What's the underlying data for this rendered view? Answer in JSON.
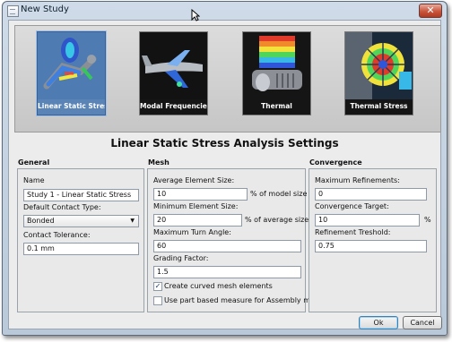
{
  "window": {
    "title": "New Study",
    "close_glyph": "✕"
  },
  "studies": [
    {
      "label": "Linear Static Stress",
      "selected": true
    },
    {
      "label": "Modal Frequencies",
      "selected": false
    },
    {
      "label": "Thermal",
      "selected": false
    },
    {
      "label": "Thermal Stress",
      "selected": false
    }
  ],
  "heading": "Linear Static Stress Analysis Settings",
  "general": {
    "title": "General",
    "name_label": "Name",
    "name_value": "Study 1 - Linear Static Stress",
    "contact_type_label": "Default Contact Type:",
    "contact_type_value": "Bonded",
    "contact_tolerance_label": "Contact Tolerance:",
    "contact_tolerance_value": "0.1 mm"
  },
  "mesh": {
    "title": "Mesh",
    "avg_size_label": "Average Element Size:",
    "avg_size_value": "10",
    "avg_size_suffix": "% of model size",
    "min_size_label": "Minimum Element Size:",
    "min_size_value": "20",
    "min_size_suffix": "% of average size",
    "turn_angle_label": "Maximum Turn Angle:",
    "turn_angle_value": "60",
    "grading_label": "Grading Factor:",
    "grading_value": "1.5",
    "curved_label": "Create curved mesh elements",
    "curved_checked": true,
    "part_based_label": "Use part based measure for Assembly mesh",
    "part_based_checked": false
  },
  "convergence": {
    "title": "Convergence",
    "max_ref_label": "Maximum Refinements:",
    "max_ref_value": "0",
    "target_label": "Convergence Target:",
    "target_value": "10",
    "target_suffix": "%",
    "threshold_label": "Refinement Treshold:",
    "threshold_value": "0.75"
  },
  "buttons": {
    "ok": "Ok",
    "cancel": "Cancel"
  },
  "colors": {
    "selected_tile": "#5b84b6",
    "title_gradient_top": "#cfdbe8"
  }
}
